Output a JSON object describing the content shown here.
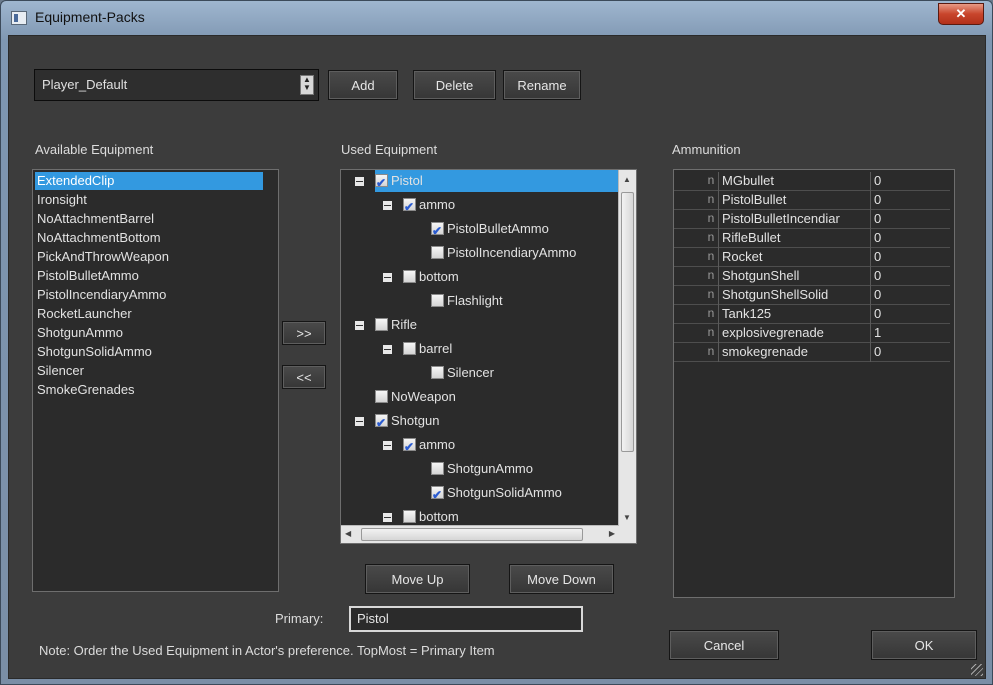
{
  "window": {
    "title": "Equipment-Packs"
  },
  "pack": {
    "selected": "Player_Default",
    "add_label": "Add",
    "delete_label": "Delete",
    "rename_label": "Rename"
  },
  "available": {
    "heading": "Available Equipment",
    "items": [
      "ExtendedClip",
      "Ironsight",
      "NoAttachmentBarrel",
      "NoAttachmentBottom",
      "PickAndThrowWeapon",
      "PistolBulletAmmo",
      "PistolIncendiaryAmmo",
      "RocketLauncher",
      "ShotgunAmmo",
      "ShotgunSolidAmmo",
      "Silencer",
      "SmokeGrenades"
    ]
  },
  "transfer": {
    "add_label": ">>",
    "remove_label": "<<"
  },
  "used": {
    "heading": "Used Equipment",
    "rows": [
      {
        "label": "Pistol",
        "checked": true
      },
      {
        "label": "ammo",
        "checked": true
      },
      {
        "label": "PistolBulletAmmo",
        "checked": true
      },
      {
        "label": "PistolIncendiaryAmmo",
        "checked": false
      },
      {
        "label": "bottom",
        "checked": false
      },
      {
        "label": "Flashlight",
        "checked": false
      },
      {
        "label": "Rifle",
        "checked": false
      },
      {
        "label": "barrel",
        "checked": false
      },
      {
        "label": "Silencer",
        "checked": false
      },
      {
        "label": "NoWeapon",
        "checked": false
      },
      {
        "label": "Shotgun",
        "checked": true
      },
      {
        "label": "ammo",
        "checked": true
      },
      {
        "label": "ShotgunAmmo",
        "checked": false
      },
      {
        "label": "ShotgunSolidAmmo",
        "checked": true
      },
      {
        "label": "bottom",
        "checked": false
      }
    ],
    "move_up_label": "Move Up",
    "move_down_label": "Move Down"
  },
  "ammunition": {
    "heading": "Ammunition",
    "row_marker": "n",
    "rows": [
      {
        "name": "MGbullet",
        "count": "0"
      },
      {
        "name": "PistolBullet",
        "count": "0"
      },
      {
        "name": "PistolBulletIncendiar",
        "count": "0"
      },
      {
        "name": "RifleBullet",
        "count": "0"
      },
      {
        "name": "Rocket",
        "count": "0"
      },
      {
        "name": "ShotgunShell",
        "count": "0"
      },
      {
        "name": "ShotgunShellSolid",
        "count": "0"
      },
      {
        "name": "Tank125",
        "count": "0"
      },
      {
        "name": "explosivegrenade",
        "count": "1"
      },
      {
        "name": "smokegrenade",
        "count": "0"
      }
    ]
  },
  "primary": {
    "label": "Primary:",
    "value": "Pistol"
  },
  "note": "Note: Order the Used Equipment in Actor's preference. TopMost = Primary Item",
  "footer": {
    "cancel_label": "Cancel",
    "ok_label": "OK"
  }
}
